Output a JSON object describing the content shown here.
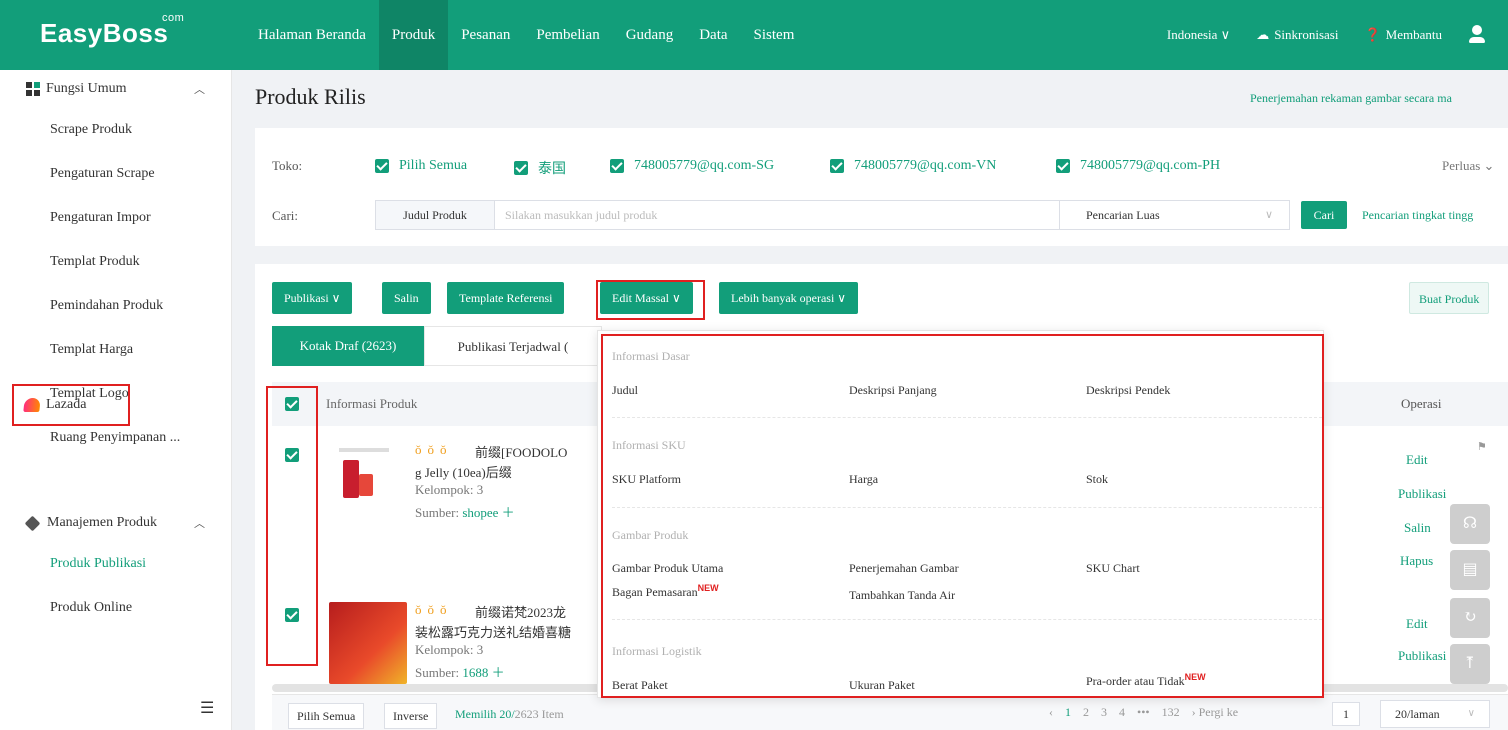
{
  "brand": {
    "name": "EasyBoss",
    "sup": "com"
  },
  "nav": {
    "items": [
      "Halaman Beranda",
      "Produk",
      "Pesanan",
      "Pembelian",
      "Gudang",
      "Data",
      "Sistem"
    ],
    "active": "Produk",
    "region": "Indonesia",
    "sync": "Sinkronisasi",
    "help": "Membantu"
  },
  "sidebar": {
    "group1": "Fungsi Umum",
    "items1": [
      "Scrape Produk",
      "Pengaturan Scrape",
      "Pengaturan Impor",
      "Templat Produk",
      "Pemindahan Produk",
      "Templat Harga",
      "Templat Logo",
      "Ruang Penyimpanan ..."
    ],
    "lazada": "Lazada",
    "group2": "Manajemen Produk",
    "items2": [
      "Produk Publikasi",
      "Produk Online"
    ]
  },
  "page": {
    "title": "Produk Rilis",
    "top_link": "Penerjemahan rekaman gambar secara ma"
  },
  "filter": {
    "toko_label": "Toko:",
    "stores": [
      "Pilih Semua",
      "泰国",
      "748005779@qq.com-SG",
      "748005779@qq.com-VN",
      "748005779@qq.com-PH"
    ],
    "expand": "Perluas",
    "cari_label": "Cari:",
    "search_type": "Judul Produk",
    "search_placeholder": "Silakan masukkan judul produk",
    "search_mode": "Pencarian Luas",
    "search_button": "Cari",
    "advanced": "Pencarian tingkat tingg"
  },
  "toolbar": {
    "publish": "Publikasi",
    "copy": "Salin",
    "template": "Template Referensi",
    "bulk_edit": "Edit Massal",
    "more": "Lebih banyak operasi",
    "create": "Buat Produk"
  },
  "tabs": {
    "draft": "Kotak Draf (2623)",
    "scheduled": "Publikasi Terjadwal ("
  },
  "table": {
    "col_info": "Informasi Produk",
    "col_op": "Operasi",
    "rows": [
      {
        "title1": "前缀[FOODOLO",
        "title2": "g Jelly (10ea)后缀",
        "group": "Kelompok:  3",
        "source_label": "Sumber:",
        "source": "shopee"
      },
      {
        "title1": "前缀诺梵2023龙",
        "title2": "装松露巧克力送礼结婚喜糖",
        "group": "Kelompok:  3",
        "source_label": "Sumber:",
        "source": "1688"
      }
    ],
    "ops": [
      "Edit",
      "Publikasi",
      "Salin",
      "Hapus"
    ]
  },
  "footer": {
    "select_all": "Pilih Semua",
    "inverse": "Inverse",
    "selected_label": "Memilih 20/",
    "selected_total": "2623 Item",
    "pages": [
      "1",
      "2",
      "3",
      "4",
      "•••",
      "132"
    ],
    "goto": "Pergi ke",
    "page_value": "1",
    "per_page": "20/laman"
  },
  "dropdown": {
    "sections": [
      {
        "title": "Informasi Dasar",
        "options": [
          "Judul",
          "Deskripsi Panjang",
          "Deskripsi Pendek"
        ]
      },
      {
        "title": "Informasi SKU",
        "options": [
          "SKU Platform",
          "Harga",
          "Stok"
        ]
      },
      {
        "title": "Gambar Produk",
        "options": [
          "Gambar Produk Utama",
          "Penerjemahan Gambar",
          "SKU Chart",
          "Bagan Pemasaran",
          "Tambahkan Tanda Air"
        ]
      },
      {
        "title": "Informasi Logistik",
        "options": [
          "Berat Paket",
          "Ukuran Paket",
          "Pra-order atau Tidak"
        ]
      }
    ],
    "new_badge": "NEW"
  },
  "colors": {
    "primary": "#129e7a",
    "highlight": "#e02020"
  }
}
